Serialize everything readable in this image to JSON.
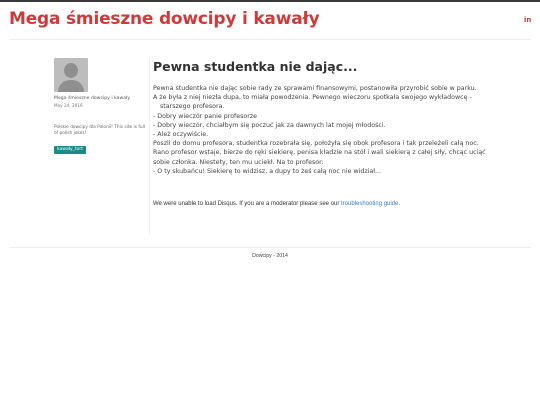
{
  "header": {
    "site_title": "Mega śmieszne dowcipy i kawały",
    "social_icon": "in"
  },
  "sidebar": {
    "avatar_icon": "default-user-avatar",
    "author": "Mega śmieszne dowcipy i kawały",
    "date": "May 24, 2016",
    "blurb": "Polskie dowcipy dla Polonii! This site is full of polish jokes!",
    "tag": "kawały_tort"
  },
  "post": {
    "title": "Pewna studentka nie dając...",
    "lines": [
      {
        "text": "Pewna studentka nie dając sobie rady ze sprawami finansowymi, postanowiła przyrobić sobie w parku.",
        "indent": false
      },
      {
        "text": "A że była z niej niezła dupa, to miała powodzenia. Pewnego wieczoru spotkała swojego wykładowcę -",
        "indent": false
      },
      {
        "text": "starszego profesora.",
        "indent": true
      },
      {
        "text": "- Dobry wieczór panie profesorze",
        "indent": false
      },
      {
        "text": "- Dobry wieczór, chciałbym się poczuć jak za dawnych lat mojej młodości.",
        "indent": false
      },
      {
        "text": "- Ależ oczywiście.",
        "indent": false
      },
      {
        "text": "Poszli do domu profesora, studentka rozebrała się, położyła się obok profesora i tak przeleżeli całą noc.",
        "indent": false
      },
      {
        "text": "Rano profesor wstaje, bierze do ręki siekierę, penisa kładzie na stół i wali siekierą z całej siły, chcąc uciąć",
        "indent": false
      },
      {
        "text": "sobie członka. Niestety, ten mu uciekł. Na to profesor:",
        "indent": false
      },
      {
        "text": "- O ty skubańcu! Siekierę to widzisz, a dupy to żeś całą noc nie widział...",
        "indent": false
      }
    ]
  },
  "disqus": {
    "message": "We were unable to load Disqus. If you are a moderator please see our ",
    "link_text": "troubleshooting guide",
    "suffix": "."
  },
  "footer": {
    "text": "Dowcipy - 2014"
  },
  "colors": {
    "brand": "#cf3b3b",
    "tag_bg": "#1b8a8a",
    "link": "#3b7bbf"
  }
}
